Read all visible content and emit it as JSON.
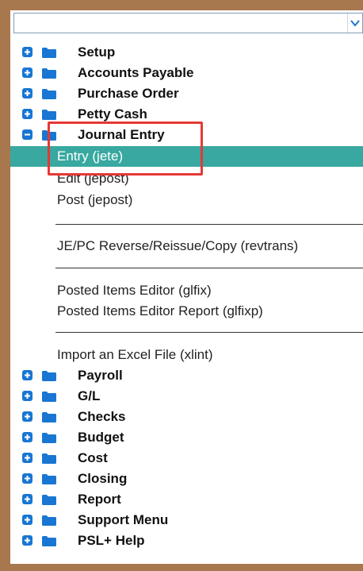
{
  "dropdown": {
    "value": ""
  },
  "tree": {
    "folders_top": [
      {
        "label": "Setup"
      },
      {
        "label": "Accounts Payable"
      },
      {
        "label": "Purchase Order"
      },
      {
        "label": "Petty Cash"
      },
      {
        "label": "Journal Entry",
        "expanded": true
      }
    ],
    "journal_items": [
      {
        "label": "Entry (jete)",
        "selected": true
      },
      {
        "label": "Edit (jepost)"
      },
      {
        "label": "Post (jepost)"
      },
      {
        "label": "JE/PC Reverse/Reissue/Copy (revtrans)"
      },
      {
        "label": "Posted Items Editor (glfix)"
      },
      {
        "label": "Posted Items Editor Report (glfixp)"
      },
      {
        "label": "Import an Excel File (xlint)"
      }
    ],
    "folders_bottom": [
      {
        "label": "Payroll"
      },
      {
        "label": "G/L"
      },
      {
        "label": "Checks"
      },
      {
        "label": "Budget"
      },
      {
        "label": "Cost"
      },
      {
        "label": "Closing"
      },
      {
        "label": "Report"
      },
      {
        "label": "Support Menu"
      },
      {
        "label": "PSL+ Help"
      }
    ]
  },
  "colors": {
    "background": "#a7774d",
    "selected_row": "#38a8a0",
    "expander": "#1976d2",
    "folder": "#1976d2",
    "annotation_box": "#e53935"
  },
  "icons": {
    "expand": "plus-box-icon",
    "collapse": "minus-box-icon",
    "folder": "folder-icon",
    "dropdown": "chevron-down-icon"
  }
}
